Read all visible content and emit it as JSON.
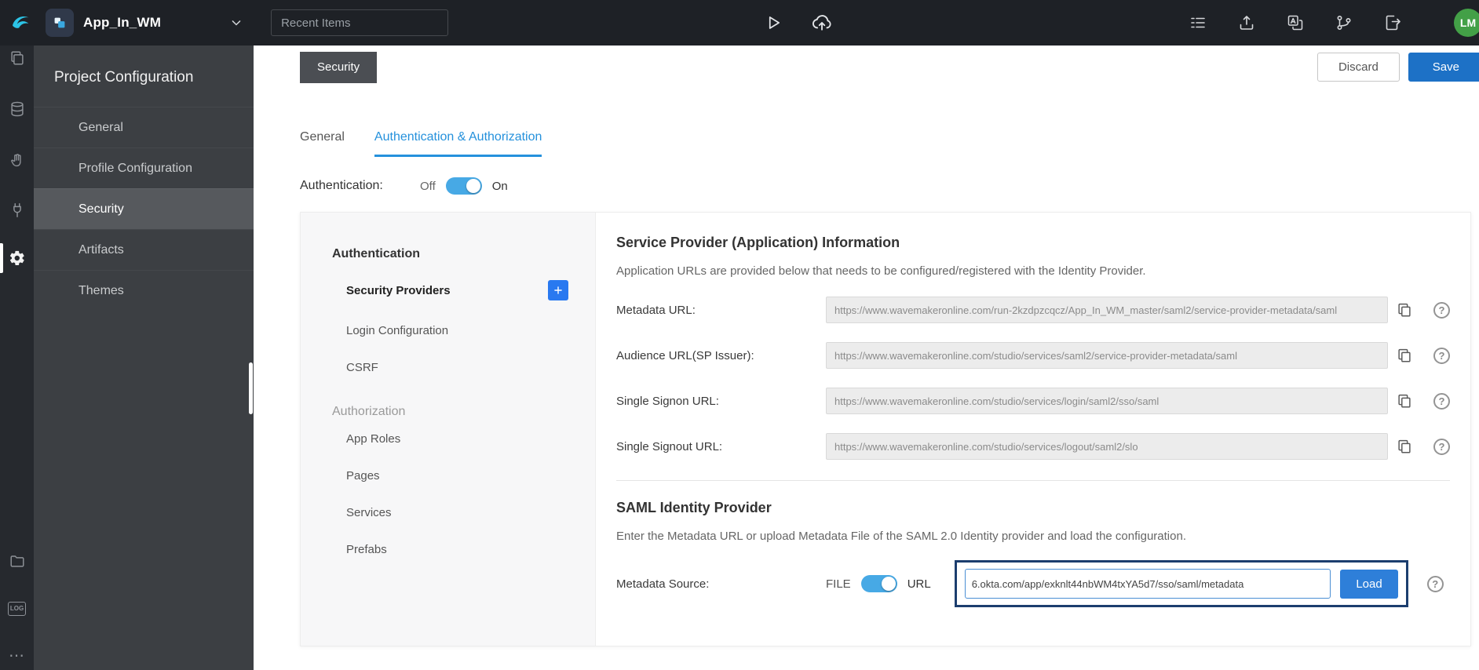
{
  "topbar": {
    "app_title": "App_In_WM",
    "recent_items_placeholder": "Recent Items",
    "avatar_initials": "LM"
  },
  "sidebar": {
    "heading": "Project Configuration",
    "items": [
      {
        "label": "General",
        "active": false
      },
      {
        "label": "Profile Configuration",
        "active": false
      },
      {
        "label": "Security",
        "active": true
      },
      {
        "label": "Artifacts",
        "active": false
      },
      {
        "label": "Themes",
        "active": false
      }
    ]
  },
  "header": {
    "file_tab": "Security",
    "discard_label": "Discard",
    "save_label": "Save"
  },
  "tabs": {
    "general": "General",
    "auth": "Authentication & Authorization",
    "active": "Authentication & Authorization"
  },
  "authentication": {
    "label": "Authentication:",
    "off_label": "Off",
    "on_label": "On",
    "state": "on"
  },
  "subnav": {
    "section_authentication": "Authentication",
    "security_providers": "Security Providers",
    "login_configuration": "Login Configuration",
    "csrf": "CSRF",
    "section_authorization": "Authorization",
    "app_roles": "App Roles",
    "pages": "Pages",
    "services": "Services",
    "prefabs": "Prefabs",
    "active_item": "Security Providers"
  },
  "service_provider": {
    "title": "Service Provider (Application) Information",
    "description": "Application URLs are provided below that needs to be configured/registered with the Identity Provider.",
    "fields": [
      {
        "label": "Metadata URL:",
        "value": "https://www.wavemakeronline.com/run-2kzdpzcqcz/App_In_WM_master/saml2/service-provider-metadata/saml"
      },
      {
        "label": "Audience URL(SP Issuer):",
        "value": "https://www.wavemakeronline.com/studio/services/saml2/service-provider-metadata/saml"
      },
      {
        "label": "Single Signon URL:",
        "value": "https://www.wavemakeronline.com/studio/services/login/saml2/sso/saml"
      },
      {
        "label": "Single Signout URL:",
        "value": "https://www.wavemakeronline.com/studio/services/logout/saml2/slo"
      }
    ]
  },
  "saml": {
    "title": "SAML Identity Provider",
    "description": "Enter the Metadata URL or upload Metadata File of the SAML 2.0 Identity provider and load the configuration.",
    "source_label": "Metadata Source:",
    "file_label": "FILE",
    "url_label": "URL",
    "source_state": "url",
    "metadata_url_value": "6.okta.com/app/exknlt44nbWM4txYA5d7/sso/saml/metadata",
    "load_label": "Load"
  },
  "icons": {
    "question_mark": "?",
    "log_label": "LOG",
    "ellipsis": "⋯"
  },
  "colors": {
    "accent_blue": "#2591dc",
    "save_blue": "#1d71c6",
    "toggle_blue": "#47a9e5",
    "load_blue": "#2e7fd9",
    "plus_blue": "#2979f0",
    "highlight_border": "#1c3e6e",
    "avatar_green": "#43a047",
    "topbar_bg": "#1e2126",
    "sidebar_bg": "#3c3f43"
  }
}
